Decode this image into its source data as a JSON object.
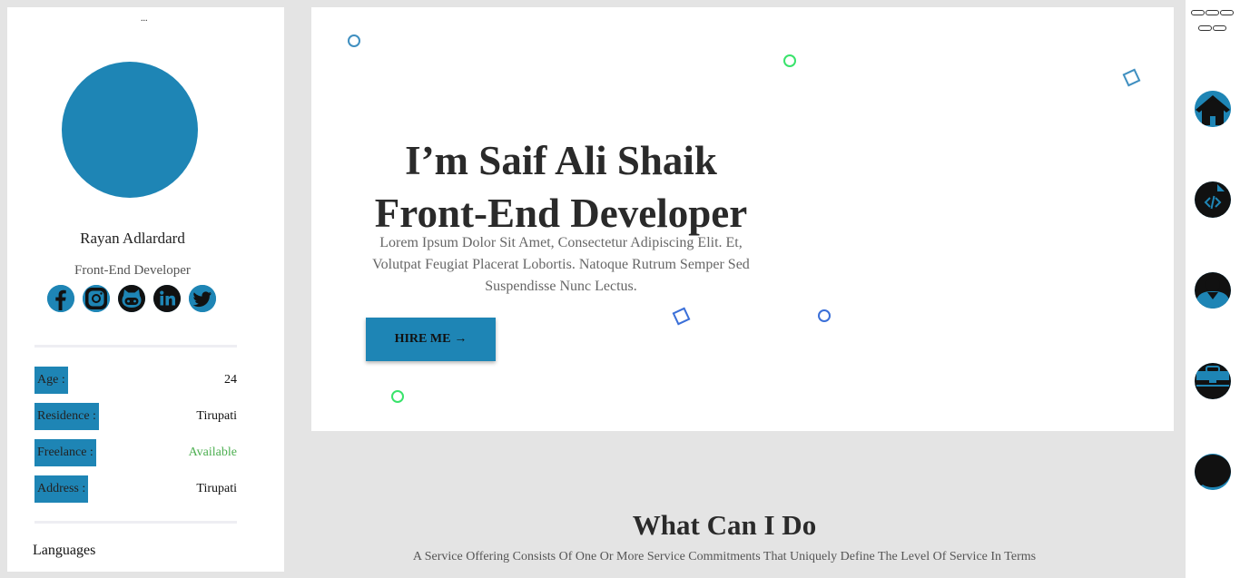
{
  "profile": {
    "menu_dots": "...",
    "name": "Rayan Adlardard",
    "role": "Front-End Developer",
    "socials": [
      "facebook-icon",
      "instagram-icon",
      "github-icon",
      "linkedin-icon",
      "twitter-icon"
    ],
    "info": [
      {
        "label": "Age :",
        "value": "24"
      },
      {
        "label": "Residence :",
        "value": "Tirupati"
      },
      {
        "label": "Freelance :",
        "value": "Available"
      },
      {
        "label": "Address :",
        "value": "Tirupati"
      }
    ],
    "languages_heading": "Languages"
  },
  "hero": {
    "title_line1": "I’m Saif Ali Shaik",
    "title_line2": "Front-End Developer",
    "description": "Lorem Ipsum Dolor Sit Amet, Consectetur Adipiscing Elit. Et, Volutpat Feugiat Placerat Lobortis. Natoque Rutrum Semper Sed Suspendisse Nunc Lectus.",
    "hire_label": "HIRE ME",
    "hire_arrow": "→"
  },
  "services": {
    "title": "What Can I Do",
    "description": "A Service Offering Consists Of One Or More Service Commitments That Uniquely Define The Level Of Service In Terms"
  },
  "nav": [
    "home-icon",
    "code-file-icon",
    "user-icon",
    "briefcase-icon",
    "chat-icon"
  ],
  "colors": {
    "accent": "#1e85b5",
    "background": "#e4e4e4",
    "available": "#4caf50",
    "shape_blue": "#3a6fd8",
    "shape_green": "#39e36b",
    "shape_teal": "#3f8fc0"
  }
}
